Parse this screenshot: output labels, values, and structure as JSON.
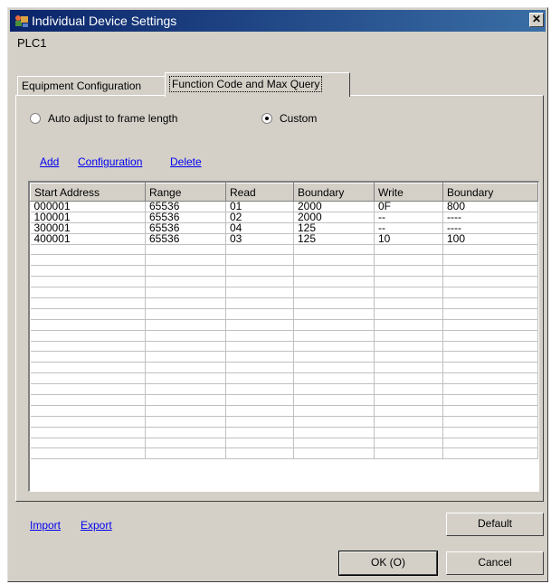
{
  "window": {
    "title": "Individual Device Settings",
    "close_glyph": "✕"
  },
  "device_label": "PLC1",
  "tabs": [
    {
      "label": "Equipment Configuration"
    },
    {
      "label": "Function Code and Max Query"
    }
  ],
  "options": {
    "auto_label": "Auto adjust to frame length",
    "custom_label": "Custom",
    "selected": "custom"
  },
  "actions": {
    "add": "Add",
    "configuration": "Configuration",
    "delete": "Delete"
  },
  "table": {
    "columns": [
      "Start Address",
      "Range",
      "Read",
      "Boundary",
      "Write",
      "Boundary"
    ],
    "rows": [
      [
        "000001",
        "65536",
        "01",
        "2000",
        "0F",
        "800"
      ],
      [
        "100001",
        "65536",
        "02",
        "2000",
        "--",
        "----"
      ],
      [
        "300001",
        "65536",
        "04",
        "125",
        "--",
        "----"
      ],
      [
        "400001",
        "65536",
        "03",
        "125",
        "10",
        "100"
      ]
    ],
    "empty_rows": 20
  },
  "footer": {
    "import": "Import",
    "export": "Export",
    "default": "Default",
    "ok": "OK (O)",
    "cancel": "Cancel"
  },
  "colors": {
    "titlebar_start": "#0a246a",
    "titlebar_end": "#3a6ea5",
    "face": "#d4d0c8",
    "link": "#0000ee"
  }
}
